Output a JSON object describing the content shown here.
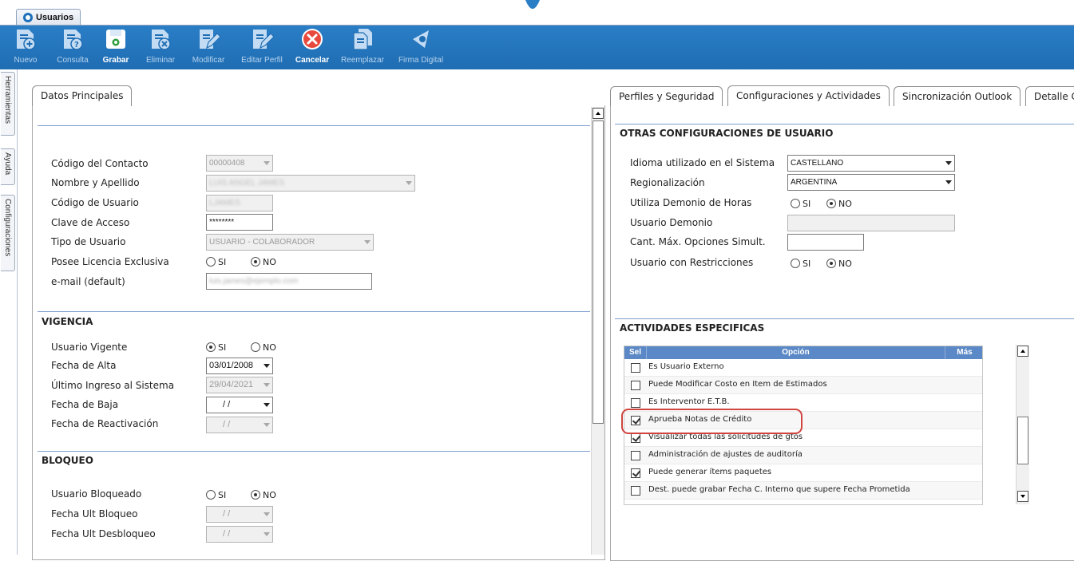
{
  "window": {
    "tab_label": "Usuarios"
  },
  "toolbar": {
    "buttons": [
      {
        "label": "Nuevo",
        "icon": "doc-add-icon",
        "enabled": false
      },
      {
        "label": "Consulta",
        "icon": "doc-query-icon",
        "enabled": false
      },
      {
        "label": "Grabar",
        "icon": "save-disk-icon",
        "enabled": true
      },
      {
        "label": "Eliminar",
        "icon": "doc-delete-icon",
        "enabled": false
      },
      {
        "label": "Modificar",
        "icon": "doc-edit-icon",
        "enabled": false
      },
      {
        "label": "Editar Perfil",
        "icon": "profile-edit-icon",
        "enabled": false
      },
      {
        "label": "Cancelar",
        "icon": "cancel-icon",
        "enabled": true
      },
      {
        "label": "Reemplazar",
        "icon": "replace-icon",
        "enabled": false
      },
      {
        "label": "Firma Digital",
        "icon": "digital-signature-icon",
        "enabled": false
      }
    ]
  },
  "side_tabs": [
    "Herramientas",
    "Ayuda",
    "Configuraciones"
  ],
  "left_panel": {
    "tab": "Datos Principales",
    "fields": {
      "codigo_contacto": {
        "label": "Código del Contacto",
        "value": "00000408"
      },
      "nombre": {
        "label": "Nombre y Apellido",
        "value": "LUIS ANGEL JAMES"
      },
      "codigo_usuario": {
        "label": "Código de Usuario",
        "value": "LJAMES"
      },
      "clave": {
        "label": "Clave de Acceso",
        "value": "********"
      },
      "tipo_usuario": {
        "label": "Tipo de Usuario",
        "value": "USUARIO - COLABORADOR"
      },
      "licencia": {
        "label": "Posee Licencia Exclusiva",
        "opt_si": "SI",
        "opt_no": "NO",
        "selected": "NO"
      },
      "email": {
        "label": "e-mail (default)",
        "value": "luis.james@ejemplo.com"
      }
    },
    "vigencia": {
      "title": "VIGENCIA",
      "usuario_vigente": {
        "label": "Usuario Vigente",
        "opt_si": "SI",
        "opt_no": "NO",
        "selected": "SI"
      },
      "fecha_alta": {
        "label": "Fecha de Alta",
        "value": "03/01/2008"
      },
      "ultimo_ingreso": {
        "label": "Último Ingreso al Sistema",
        "value": "29/04/2021"
      },
      "fecha_baja": {
        "label": "Fecha de Baja",
        "value": "/ /"
      },
      "fecha_reactivacion": {
        "label": "Fecha de Reactivación",
        "value": "/ /"
      }
    },
    "bloqueo": {
      "title": "BLOQUEO",
      "usuario_bloqueado": {
        "label": "Usuario Bloqueado",
        "opt_si": "SI",
        "opt_no": "NO",
        "selected": "NO"
      },
      "fecha_ult_bloqueo": {
        "label": "Fecha Ult Bloqueo",
        "value": "/ /"
      },
      "fecha_ult_desbloqueo": {
        "label": "Fecha Ult Desbloqueo",
        "value": "/ /"
      }
    }
  },
  "right_panel": {
    "tabs": [
      "Perfiles y Seguridad",
      "Configuraciones y Actividades",
      "Sincronización Outlook",
      "Detalle C"
    ],
    "active_tab": "Configuraciones y Actividades",
    "otras": {
      "title": "OTRAS CONFIGURACIONES DE USUARIO",
      "idioma": {
        "label": "Idioma utilizado en el Sistema",
        "value": "CASTELLANO"
      },
      "regionalizacion": {
        "label": "Regionalización",
        "value": "ARGENTINA"
      },
      "demonio_horas": {
        "label": "Utiliza Demonio de Horas",
        "opt_si": "SI",
        "opt_no": "NO",
        "selected": "NO"
      },
      "usuario_demonio": {
        "label": "Usuario Demonio",
        "value": ""
      },
      "cant_max": {
        "label": "Cant. Máx. Opciones Simult.",
        "value": ""
      },
      "restricciones": {
        "label": "Usuario con Restricciones",
        "opt_si": "SI",
        "opt_no": "NO",
        "selected": "NO"
      }
    },
    "actividades": {
      "title": "ACTIVIDADES ESPECIFICAS",
      "columns": [
        "Sel",
        "Opción",
        "Más"
      ],
      "rows": [
        {
          "label": "Es Usuario Externo",
          "checked": false
        },
        {
          "label": "Puede Modificar Costo en Item de Estimados",
          "checked": false
        },
        {
          "label": "Es Interventor E.T.B.",
          "checked": false
        },
        {
          "label": "Aprueba Notas de Crédito",
          "checked": true
        },
        {
          "label": "Visualizar todas las solicitudes de gtos",
          "checked": true
        },
        {
          "label": "Administración de ajustes de auditoría",
          "checked": false
        },
        {
          "label": "Puede generar ítems paquetes",
          "checked": true
        },
        {
          "label": "Dest. puede grabar Fecha C. Interno que supere Fecha Prometida",
          "checked": false
        }
      ]
    }
  },
  "colors": {
    "toolbar": "#1f6db3",
    "table_header": "#5b88c6",
    "highlight": "#d0453f"
  }
}
